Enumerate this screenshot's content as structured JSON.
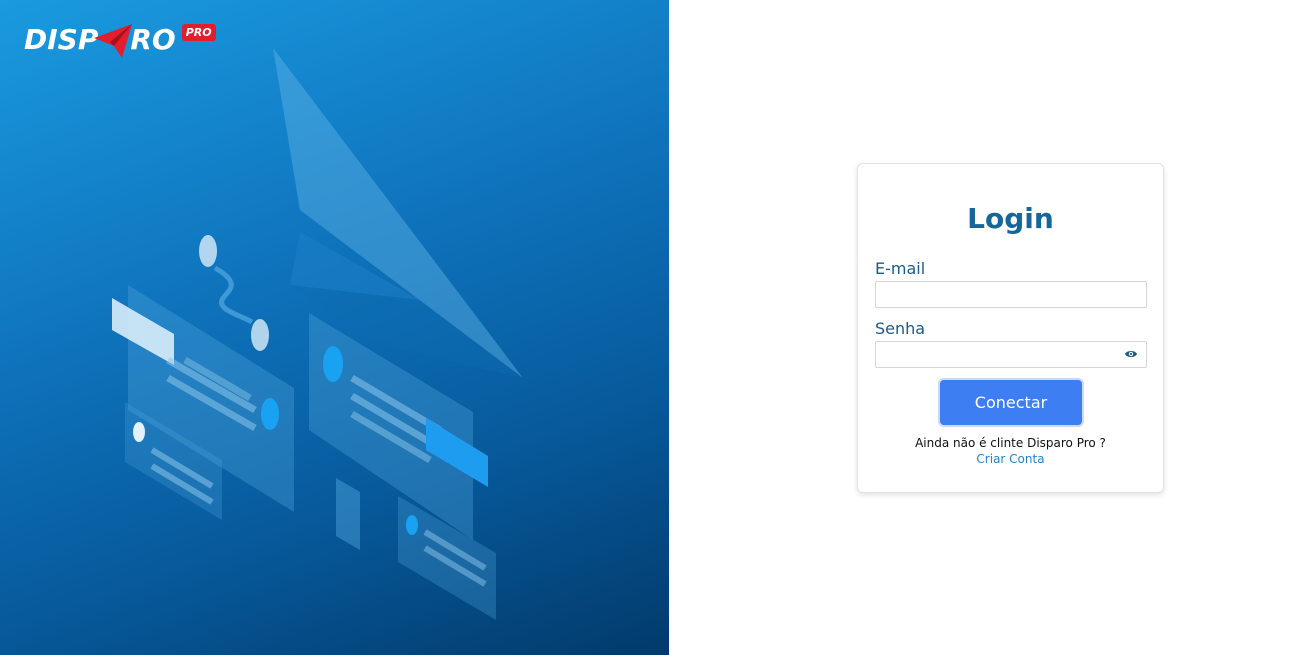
{
  "brand": {
    "logo_text_left": "DISP",
    "logo_text_right": "RO",
    "logo_badge": "PRO",
    "badge_color": "#e31e2c"
  },
  "login": {
    "title": "Login",
    "email_label": "E-mail",
    "email_value": "",
    "password_label": "Senha",
    "password_value": "",
    "password_toggle_icon": "eye-icon",
    "submit_label": "Conectar",
    "signup_prompt": "Ainda não é clinte Disparo Pro ?",
    "signup_link": "Criar Conta"
  },
  "colors": {
    "title": "#14669b",
    "button": "#3d7ef2",
    "link": "#1e88c8",
    "panel_top": "#1a9ae0",
    "panel_bottom": "#023a6b"
  }
}
